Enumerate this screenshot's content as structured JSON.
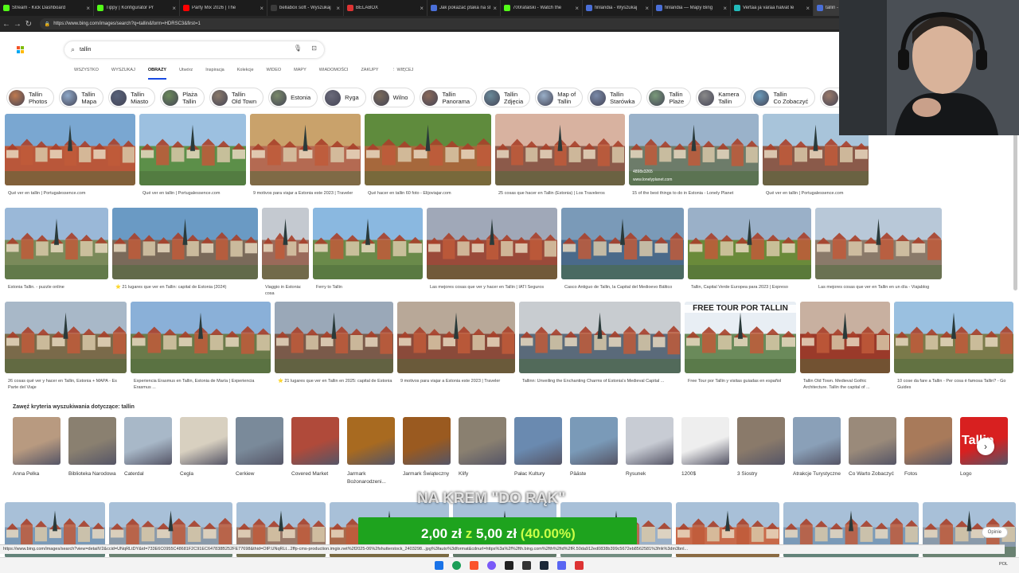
{
  "browser": {
    "tabs": [
      {
        "title": "Stream - Kick Dashboard",
        "color": "#53fc18"
      },
      {
        "title": "Tippy | Konfigurator Pr",
        "color": "#53fc18"
      },
      {
        "title": "Party Mix 2026 | The",
        "color": "#ff0000"
      },
      {
        "title": "bellabox soft - Wyszukaj",
        "color": "#3b3b3b"
      },
      {
        "title": "BELABOX",
        "color": "#d33"
      },
      {
        "title": "Jak pokazać ptaka na str",
        "color": "#4a6fd8"
      },
      {
        "title": "700rafalski - Watch the",
        "color": "#53fc18"
      },
      {
        "title": "finlandia - Wyszukaj",
        "color": "#4a6fd8"
      },
      {
        "title": "finlandia — Mapy Bing",
        "color": "#4a6fd8"
      },
      {
        "title": "Vertaa ja varaa halvat le",
        "color": "#2bb"
      },
      {
        "title": "tallin - Wyszukaj",
        "color": "#4a6fd8"
      }
    ],
    "url": "https://www.bing.com/images/search?q=tallin&form=HDRSC3&first=1"
  },
  "search": {
    "query": "tallin"
  },
  "scopes": [
    "WSZYSTKO",
    "WYSZUKAJ",
    "OBRAZY",
    "Utwórz",
    "Inspiracja",
    "Kolekcje",
    "WIDEO",
    "MAPY",
    "WIADOMOŚCI",
    "ZAKUPY",
    "⋮ WIĘCEJ"
  ],
  "chips": [
    {
      "line1": "Tallin",
      "line2": "Photos",
      "c": "#c07a4f"
    },
    {
      "line1": "Tallin",
      "line2": "Mapa",
      "c": "#8fa9c9"
    },
    {
      "line1": "Tallin",
      "line2": "Miasto",
      "c": "#57627a"
    },
    {
      "line1": "Plaża",
      "line2": "Tallin",
      "c": "#6b8a5a"
    },
    {
      "line1": "Tallin",
      "line2": "Old Town",
      "c": "#8a7a6a"
    },
    {
      "line1": "Estonia",
      "line2": "",
      "c": "#7a8a6a"
    },
    {
      "line1": "Ryga",
      "line2": "",
      "c": "#6a6a7a"
    },
    {
      "line1": "Wilno",
      "line2": "",
      "c": "#7a6a5a"
    },
    {
      "line1": "Tallin",
      "line2": "Panorama",
      "c": "#8a6a5a"
    },
    {
      "line1": "Tallin",
      "line2": "Zdjęcia",
      "c": "#6a8a9a"
    },
    {
      "line1": "Map of",
      "line2": "Tallin",
      "c": "#9ab0c9"
    },
    {
      "line1": "Tallin",
      "line2": "Starówka",
      "c": "#7a8aa9"
    },
    {
      "line1": "Tallin",
      "line2": "Plaże",
      "c": "#7a9a7a"
    },
    {
      "line1": "Kamera",
      "line2": "Tallin",
      "c": "#8a8a8a"
    },
    {
      "line1": "Tallin",
      "line2": "Co Zobaczyć",
      "c": "#6a9aba"
    },
    {
      "line1": "Ta",
      "line2": "M",
      "c": "#9a7a6a"
    }
  ],
  "grid_rows": [
    [
      {
        "cap": "Qué ver en tallin | Portugalessence.com",
        "c1": "#b9573a",
        "c2": "#7aa7d1"
      },
      {
        "cap": "Qué ver en tallin | Portugalessence.com",
        "c1": "#5c8f49",
        "c2": "#9cc0e0"
      },
      {
        "cap": "9 motivos para viajar a Estonia este 2023 | Traveler",
        "c1": "#b46a52",
        "c2": "#c9a26b"
      },
      {
        "cap": "Qué hacer en tallin 60 foto - Elijoviajar.com",
        "c1": "#a6683c",
        "c2": "#5f8b3d"
      },
      {
        "cap": "25 cosas que hacer en Tallin (Estonia) | Los Traveleros",
        "c1": "#8c5a4a",
        "c2": "#d8b2a0"
      },
      {
        "cap": "15 of the best things to do in Estonia - Lonely Planet",
        "c1": "#6d7c6a",
        "c2": "#9ab2ca",
        "dim": "4898x3265",
        "src": "www.lonelyplanet.com"
      },
      {
        "cap": "Qué ver en tallin | Portugalessence.com",
        "c1": "#8a5a4a",
        "c2": "#a8c4da"
      }
    ],
    [
      {
        "cap": "Estonia Tallin. - puzzle online",
        "c1": "#7a8a5a",
        "c2": "#9ab8d8"
      },
      {
        "cap": "⭐ 21 lugares que ver en Tallin: capital de Estonia (2024)",
        "c1": "#7a6a5a",
        "c2": "#6a9ac4"
      },
      {
        "cap": "Viaggio in Estonia: cosa",
        "c1": "#9a6a5a",
        "c2": "#c4c9d0"
      },
      {
        "cap": "Ferry to Tallin",
        "c1": "#6a8a4a",
        "c2": "#8ab8e0"
      },
      {
        "cap": "Las mejores cosas que ver y hacer en Tallin | IATI Seguros",
        "c1": "#9a4a3a",
        "c2": "#a0a8b8"
      },
      {
        "cap": "Casco Antiguo de Tallin, la Capital del Medioevo Báltico",
        "c1": "#4a6a8a",
        "c2": "#7a9ab8"
      },
      {
        "cap": "Tallin, Capital Verde Europea para 2023 | Expreso",
        "c1": "#6a8a3a",
        "c2": "#9ab0c8"
      },
      {
        "cap": "Las mejores cosas que ver en Tallin en un día - Viajablog",
        "c1": "#8a7a6a",
        "c2": "#b8c8d8"
      }
    ],
    [
      {
        "cap": "26 cosas qué ver y hacer en Tallin, Estonia + MAPA - Es Parte del Viaje",
        "c1": "#7a6a4a",
        "c2": "#a8b8c8"
      },
      {
        "cap": "Experiencia Erasmus en Tallin, Estonia de María | Experiencia Erasmus ...",
        "c1": "#6a7a4a",
        "c2": "#8ab0d8"
      },
      {
        "cap": "⭐ 21 lugares que ver en Tallin en 2025: capital de Estonia",
        "c1": "#7a5a4a",
        "c2": "#9aa8b8"
      },
      {
        "cap": "9 motivos para viajar a Estonia este 2023 | Traveler",
        "c1": "#8a4a3a",
        "c2": "#b8a898"
      },
      {
        "cap": "Tallinn: Unveiling the Enchanting Charms of Estonia's Medieval Capital ...",
        "c1": "#5a6a7a",
        "c2": "#c8ccd0"
      },
      {
        "cap": "Free Tour por Tallin y visitas guiadas en español",
        "c1": "#6a8a5a",
        "c2": "#e8eef4",
        "overlay": "FREE TOUR POR TALLIN"
      },
      {
        "cap": "Tallin Old Town. Medieval Gothic Architecture. Tallin the capital of ...",
        "c1": "#9a3a2a",
        "c2": "#c8b0a0"
      },
      {
        "cap": "10 cose da fare a Tallin - Per cosa è famosa Tallin? - Go Guides",
        "c1": "#7a7a4a",
        "c2": "#9ac0e0"
      }
    ]
  ],
  "related": {
    "title": "Zawęź kryteria wyszukiwania dotyczące: tallin",
    "items": [
      {
        "label": "Anna Pelka",
        "c": "#b89a80"
      },
      {
        "label": "Biblioteka Narodowa",
        "c": "#8a8070"
      },
      {
        "label": "Caterdal",
        "c": "#a8b8c8"
      },
      {
        "label": "Cegla",
        "c": "#d8d0c0"
      },
      {
        "label": "Cerkiew",
        "c": "#7a8a9a"
      },
      {
        "label": "Covered Market",
        "c": "#b04a3a"
      },
      {
        "label": "Jarmark Bożonarodzeni...",
        "c": "#a86a20"
      },
      {
        "label": "Jarmark Świąteczny",
        "c": "#9a5a20"
      },
      {
        "label": "Klify",
        "c": "#8a8070"
      },
      {
        "label": "Pałac Kultury",
        "c": "#6a8ab0"
      },
      {
        "label": "Pääste",
        "c": "#7a9ab8"
      },
      {
        "label": "Rysunek",
        "c": "#c8ccd4"
      },
      {
        "label": "1200$",
        "c": "#eeeeee"
      },
      {
        "label": "3 Siostry",
        "c": "#8a7a6a"
      },
      {
        "label": "Atrakcje Turystyczne",
        "c": "#8aa0b8"
      },
      {
        "label": "Co Warto Zobaczyć",
        "c": "#9a8a7a"
      },
      {
        "label": "Fotos",
        "c": "#a87a5a"
      },
      {
        "label": "Logo",
        "c": "#d82020",
        "logo": "Tallin"
      }
    ]
  },
  "bottom_row_colors": [
    "#7a9ab8",
    "#8a9aaa",
    "#9a7a6a",
    "#aa6a4a",
    "#7a8a9a",
    "#9ab0c8",
    "#c86a4a"
  ],
  "overlay": {
    "top_text": "NA KREM \"DO RĄK\"",
    "price_new": "2,00 zł",
    "price_sep": "z",
    "price_old": "5,00 zł",
    "percent": "(40.00%)"
  },
  "status_url": "https://www.bing.com/images/search?view=detailV2&ccid=UNqRLtDY&id=733E6C0955C48681F2C91EC647838B252FE77698&thid=OIP.UNqRLt...2ffp-cms-production.imgix.net%2f2025-06%2fshutterstock_2403298...jpg%3fauto%3dformat&cdnurl=https%3a%2f%2fth.bing.com%2fth%2fid%2fR.50da912ed0838b399c5672eb8562581%3frik%3dm3bnl...",
  "feedback": "Opinie",
  "tray": {
    "lang": "POL",
    "time": ""
  }
}
